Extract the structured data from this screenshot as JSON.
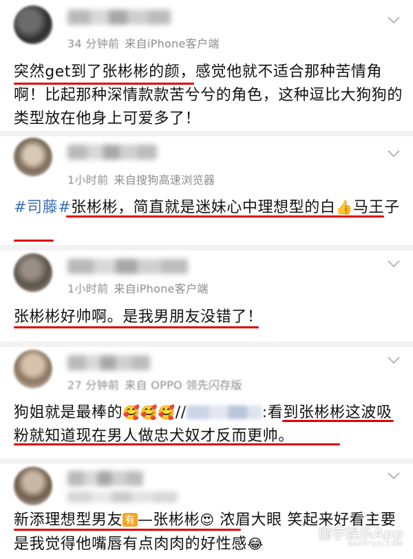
{
  "posts": [
    {
      "time": "34 分钟前",
      "source": "来自iPhone客户端",
      "text": "突然get到了张彬彬的颜，感觉他就不适合那种苦情角啊！比起那种深情款款苦兮兮的角色，这种逗比大狗狗的类型放在他身上可爱多了！"
    },
    {
      "time": "1小时前",
      "source": "来自搜狗高速浏览器",
      "tag": "#司藤#",
      "text": "张彬彬，简直就是迷妹心中理想型的白",
      "emoji": "👍",
      "text2": "马王子"
    },
    {
      "time": "1小时前",
      "source": "来自iPhone客户端",
      "text": "张彬彬好帅啊。是我男朋友没错了！"
    },
    {
      "time": "27 分钟前",
      "source": "来自 OPPO 领先闪存版",
      "text": "狗姐就是最棒的",
      "emoji": "🥰🥰🥰",
      "text_sep": "//",
      "text2": ":看到张彬彬这波吸粉就知道现在男人做忠犬奴才反而更帅。"
    },
    {
      "time": "",
      "source": "",
      "text": "新添理想型男友",
      "badge": "有",
      "text2": "—张彬彬",
      "emoji": "😍",
      "text3": "浓眉大眼 笑起来好看主要是我觉得他嘴唇有点肉肉的好性感",
      "emoji2": "😂"
    }
  ],
  "watermark": {
    "main": "偷字娱乐App",
    "sub": "NAPPFUZI.COM"
  },
  "colors": {
    "underline": "#e00000",
    "tag": "#3b6fb7",
    "meta": "#8c8c8c",
    "separator": "#f2f2f2"
  }
}
